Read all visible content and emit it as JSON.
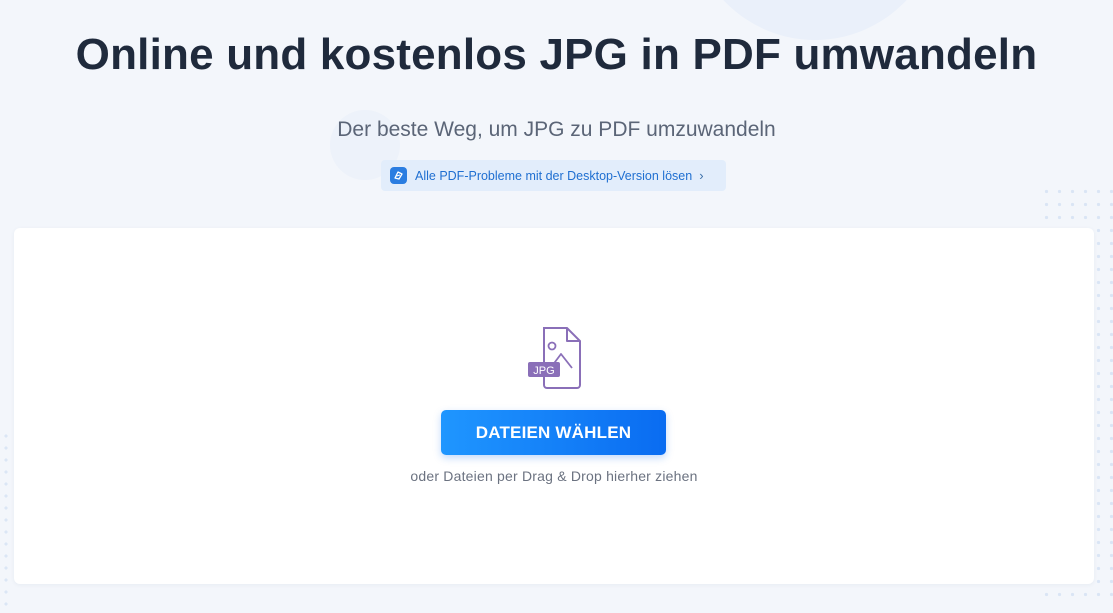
{
  "header": {
    "title": "Online und kostenlos JPG in PDF umwandeln",
    "subtitle": "Der beste Weg, um JPG zu PDF umzuwandeln"
  },
  "promo": {
    "label": "Alle PDF-Probleme mit der Desktop-Version lösen",
    "icon": "app-logo-icon",
    "arrow_icon": "chevron-right-icon"
  },
  "upload": {
    "file_icon": "jpg-file-icon",
    "file_badge": "JPG",
    "button_label": "DATEIEN WÄHLEN",
    "drop_hint": "oder Dateien per Drag & Drop hierher ziehen"
  },
  "colors": {
    "background": "#f3f6fb",
    "title": "#1f2a3c",
    "accent": "#0a6cf1",
    "link": "#1f6fd1",
    "icon_purple": "#8a6fb8"
  }
}
